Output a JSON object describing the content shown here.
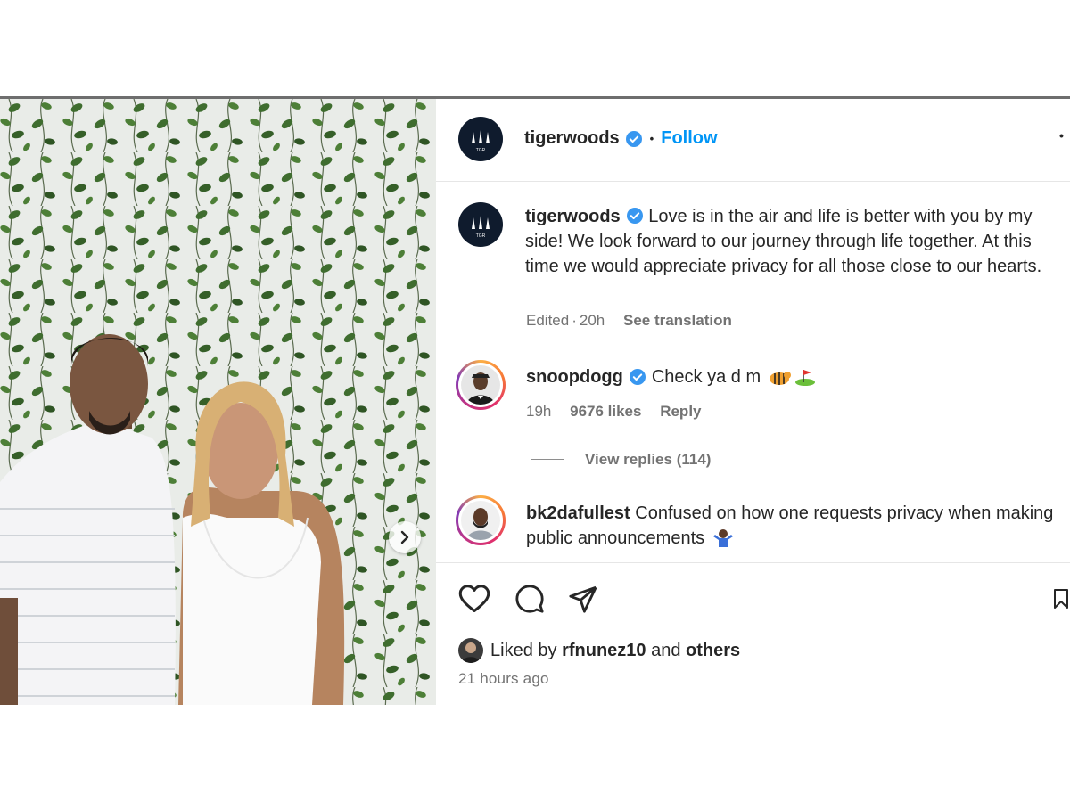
{
  "post": {
    "author": "tigerwoods",
    "follow_label": "Follow",
    "separator": "•",
    "more_label": "•",
    "avatar_logo_text": "TGR"
  },
  "caption": {
    "username": "tigerwoods",
    "text": "Love is in the air and life is better with you by my side! We look forward to our journey through life together. At this time we would appreciate privacy for all those close to our hearts.",
    "edited": "Edited",
    "dot": "·",
    "time": "20h",
    "see_translation": "See translation"
  },
  "comments": [
    {
      "username": "snoopdogg",
      "text": "Check ya d m",
      "emojis": [
        "tiger-emoji",
        "golf-flag-emoji"
      ],
      "time": "19h",
      "likes": "9676 likes",
      "reply": "Reply",
      "view_replies": "View replies (114)"
    },
    {
      "username": "bk2dafullest",
      "text": "Confused on how one requests privacy when making public announcements",
      "emojis": [
        "person-shrugging-emoji"
      ]
    }
  ],
  "actions": {
    "icons": [
      "heart-icon",
      "comment-icon",
      "share-icon",
      "bookmark-icon"
    ]
  },
  "likes": {
    "prefix": "Liked by",
    "user": "rfnunez10",
    "middle": "and",
    "others": "others",
    "timestamp": "21 hours ago"
  },
  "colors": {
    "accent": "#0095f6",
    "verified": "#3897f0",
    "text": "#262626",
    "muted": "#737373"
  }
}
